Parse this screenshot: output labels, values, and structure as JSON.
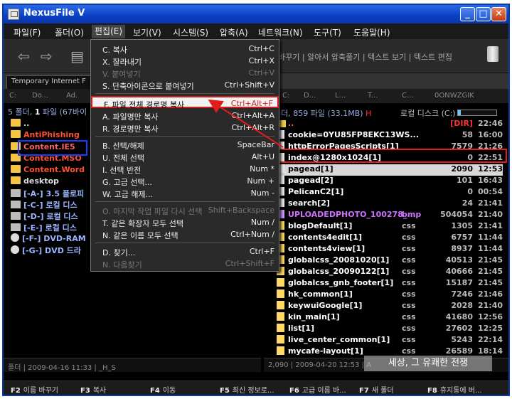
{
  "window": {
    "title": "NexusFile V",
    "minimize": "_",
    "maximize": "□",
    "close": "✕"
  },
  "menubar": [
    "파일(F)",
    "폴더(O)",
    "편집(E)",
    "보기(V)",
    "시스템(S)",
    "압축(A)",
    "네트워크(N)",
    "도구(T)",
    "도움말(H)"
  ],
  "toolbar": {
    "labels": "바꾸기 | 알아서 압축풀기 | 텍스트 보기 | 텍스트 편집"
  },
  "left_pane": {
    "tab": "Temporary Internet F",
    "path": [
      "C:",
      "Do...",
      "Ad."
    ],
    "summary_prefix": "5",
    "summary_mid": " 폴더, ",
    "summary_files": "1",
    "summary_suffix": " 파일 (67바이",
    "items": [
      {
        "name": "..",
        "color": "white",
        "icon": "folder"
      },
      {
        "name": "AntiPhishing",
        "color": "red",
        "icon": "folder"
      },
      {
        "name": "Content.IE5",
        "color": "pink",
        "icon": "folder"
      },
      {
        "name": "Content.MSO",
        "color": "red",
        "icon": "folder"
      },
      {
        "name": "Content.Word",
        "color": "red",
        "icon": "folder"
      },
      {
        "name": "desktop",
        "color": "white",
        "icon": "folder"
      },
      {
        "name": "[-A-] 3.5 플로피",
        "color": "blue",
        "icon": "drive"
      },
      {
        "name": "[-C-] 로컬 디스",
        "color": "blue",
        "icon": "drive"
      },
      {
        "name": "[-D-] 로컬 디스",
        "color": "blue",
        "icon": "drive"
      },
      {
        "name": "[-E-] 로컬 디스",
        "color": "blue",
        "icon": "drive"
      },
      {
        "name": "[-F-] DVD-RAM",
        "color": "blue",
        "icon": "cd"
      },
      {
        "name": "[-G-] DVD 드라",
        "color": "blue",
        "icon": "cd"
      }
    ],
    "status": "폴더 | 2009-04-16 11:33 | _H_S"
  },
  "right_pane": {
    "path": [
      "C:",
      "D...",
      "L...",
      "T...",
      "C...",
      "0ONWZGIK"
    ],
    "summary": "폴더, 859 파일 (33.1MB)",
    "summary_flag": "H",
    "disk": "로컬 디스크 (C:)",
    "files": [
      {
        "name": "..",
        "ext": "",
        "size": "[DIR]",
        "time": "22:46",
        "folder": true
      },
      {
        "name": "cookie=0YU85FP8EKC13WS...",
        "ext": "",
        "size": "58",
        "time": "16:00"
      },
      {
        "name": "httpErrorPagesScripts[1]",
        "ext": "",
        "size": "7579",
        "time": "21:26"
      },
      {
        "name": "index@1280x1024[1]",
        "ext": "",
        "size": "0",
        "time": "22:51"
      },
      {
        "name": "pagead[1]",
        "ext": "",
        "size": "2090",
        "time": "12:53"
      },
      {
        "name": "pagead[2]",
        "ext": "",
        "size": "101",
        "time": "16:43"
      },
      {
        "name": "PelicanC2[1]",
        "ext": "",
        "size": "0",
        "time": "00:54"
      },
      {
        "name": "search[2]",
        "ext": "",
        "size": "24",
        "time": "21:41"
      },
      {
        "name": "UPLOADEDPHOTO_100278_...",
        "ext": "bmp",
        "size": "504054",
        "time": "21:40"
      },
      {
        "name": "blogDefault[1]",
        "ext": "css",
        "size": "1305",
        "time": "21:41"
      },
      {
        "name": "contents4edit[1]",
        "ext": "css",
        "size": "6757",
        "time": "11:44"
      },
      {
        "name": "contents4view[1]",
        "ext": "css",
        "size": "8937",
        "time": "11:44"
      },
      {
        "name": "globalcss_20081020[1]",
        "ext": "css",
        "size": "40513",
        "time": "21:45"
      },
      {
        "name": "globalcss_20090122[1]",
        "ext": "css",
        "size": "40666",
        "time": "21:45"
      },
      {
        "name": "globalcss_gnb_footer[1]",
        "ext": "css",
        "size": "15187",
        "time": "21:45"
      },
      {
        "name": "hk_common[1]",
        "ext": "css",
        "size": "7246",
        "time": "21:46"
      },
      {
        "name": "keywuiGoogle[1]",
        "ext": "css",
        "size": "2028",
        "time": "21:40"
      },
      {
        "name": "kin_main[1]",
        "ext": "css",
        "size": "41680",
        "time": "12:56"
      },
      {
        "name": "list[1]",
        "ext": "css",
        "size": "27602",
        "time": "12:25"
      },
      {
        "name": "live_center_common[1]",
        "ext": "css",
        "size": "5243",
        "time": "22:14"
      },
      {
        "name": "mycafe-layout[1]",
        "ext": "css",
        "size": "26589",
        "time": "18:14"
      }
    ],
    "status": "2,090 | 2009-04-20 12:53 | A"
  },
  "edit_menu": [
    {
      "label": "C. 복사",
      "shortcut": "Ctrl+C"
    },
    {
      "label": "X. 잘라내기",
      "shortcut": "Ctrl+X"
    },
    {
      "label": "V. 붙여넣기",
      "shortcut": "Ctrl+V",
      "disabled": true
    },
    {
      "label": "S. 단축아이콘으로 붙여넣기",
      "shortcut": "Ctrl+Shift+V"
    },
    {
      "sep": true
    },
    {
      "label": "F. 파일 전체 경로명 복사",
      "shortcut": "Ctrl+Alt+F",
      "highlight": true
    },
    {
      "label": "A. 파일명만 복사",
      "shortcut": "Ctrl+Alt+A"
    },
    {
      "label": "R. 경로명만 복사",
      "shortcut": "Ctrl+Alt+R"
    },
    {
      "sep": true
    },
    {
      "label": "B. 선택/해제",
      "shortcut": "SpaceBar"
    },
    {
      "label": "U. 전체 선택",
      "shortcut": "Alt+U"
    },
    {
      "label": "I. 선택 반전",
      "shortcut": "Num *"
    },
    {
      "label": "G. 고급 선택...",
      "shortcut": "Num +"
    },
    {
      "label": "W. 고급 해제...",
      "shortcut": "Num -"
    },
    {
      "sep": true
    },
    {
      "label": "O. 마지막 작업 파일 다시 선택",
      "shortcut": "Shift+Backspace",
      "disabled": true
    },
    {
      "label": "T. 같은 확장자 모두 선택",
      "shortcut": "Num /"
    },
    {
      "label": "N. 같은 이름 모두 선택",
      "shortcut": "Ctrl+Num /"
    },
    {
      "sep": true
    },
    {
      "label": "D. 찾기...",
      "shortcut": "Ctrl+F"
    },
    {
      "label": "N. 다음찾기",
      "shortcut": "Ctrl+Shift+F",
      "disabled": true
    }
  ],
  "function_keys": [
    {
      "key": "F2",
      "label": "이름 바꾸기"
    },
    {
      "key": "F3",
      "label": "복사"
    },
    {
      "key": "F4",
      "label": "이동"
    },
    {
      "key": "F5",
      "label": "최신 정보로..."
    },
    {
      "key": "F6",
      "label": "고급 이름 바..."
    },
    {
      "key": "F7",
      "label": "새 폴더"
    },
    {
      "key": "F8",
      "label": "휴지통에 버..."
    }
  ],
  "watermark": "세상, 그 유쾌한 전쟁",
  "colors": {
    "highlight_box": "#e21b1b",
    "selection_box": "#1a3cff",
    "titlebar": "#0a3fc4"
  }
}
